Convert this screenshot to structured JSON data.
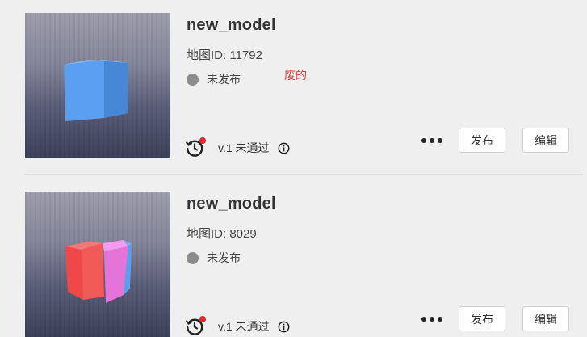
{
  "models": [
    {
      "title": "new_model",
      "map_id": "地图ID: 11792",
      "status": "未发布",
      "note": "废的",
      "version": "v.1 未通过",
      "publish_label": "发布",
      "edit_label": "编辑",
      "cube_colors": [
        "#5b9ff0",
        "#4a8ad8",
        "#79b4f7"
      ]
    },
    {
      "title": "new_model",
      "map_id": "地图ID: 8029",
      "status": "未发布",
      "version": "v.1 未通过",
      "publish_label": "发布",
      "edit_label": "编辑",
      "cube_colors": [
        "#f25a58",
        "#e87ce0",
        "#5b9ff0"
      ]
    }
  ],
  "colors": {
    "background": "#efefef",
    "note_red": "#e8373d",
    "status_dot": "#8c8c8c",
    "history_badge": "#e5262a"
  }
}
